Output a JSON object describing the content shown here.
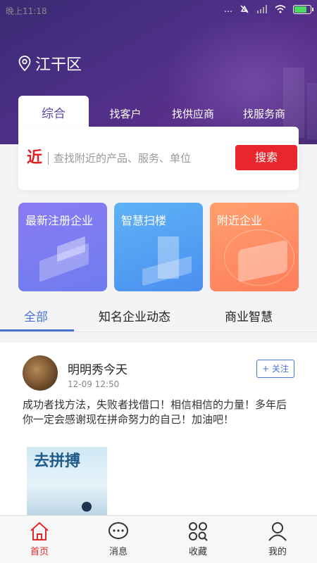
{
  "status_bar": {
    "time": "晚上11:18",
    "network": "…",
    "battery_level": 0.7
  },
  "location": {
    "name": "江干区"
  },
  "search": {
    "tabs": [
      {
        "label": "综合",
        "active": true
      },
      {
        "label": "找客户",
        "active": false
      },
      {
        "label": "找供应商",
        "active": false
      },
      {
        "label": "找服务商",
        "active": false
      }
    ],
    "logo_text": "近",
    "placeholder": "查找附近的产品、服务、单位",
    "button_label": "搜索"
  },
  "feature_cards": [
    {
      "title": "最新注册企业",
      "color": "#7c7cf2"
    },
    {
      "title": "智慧扫楼",
      "color": "#5aa6f4"
    },
    {
      "title": "附近企业",
      "color": "#ff8d62"
    }
  ],
  "content_tabs": [
    {
      "label": "全部",
      "active": true
    },
    {
      "label": "知名企业动态",
      "active": false
    },
    {
      "label": "商业智慧",
      "active": false
    }
  ],
  "post": {
    "author": "明明秀今天",
    "time": "12-09 12:50",
    "follow_label": "+ 关注",
    "text": "成功者找方法，失败者找借口！相信相信的力量！多年后你一定会感谢现在拼命努力的自己！加油吧！",
    "image_text": "去拼搏"
  },
  "bottom_nav": [
    {
      "label": "首页",
      "icon": "home-icon",
      "active": true
    },
    {
      "label": "消息",
      "icon": "message-icon",
      "active": false
    },
    {
      "label": "收藏",
      "icon": "favorites-icon",
      "active": false
    },
    {
      "label": "我的",
      "icon": "profile-icon",
      "active": false
    }
  ],
  "colors": {
    "accent_red": "#e8262b",
    "accent_blue": "#4a72d6",
    "header_purple": "#4b2f86"
  }
}
